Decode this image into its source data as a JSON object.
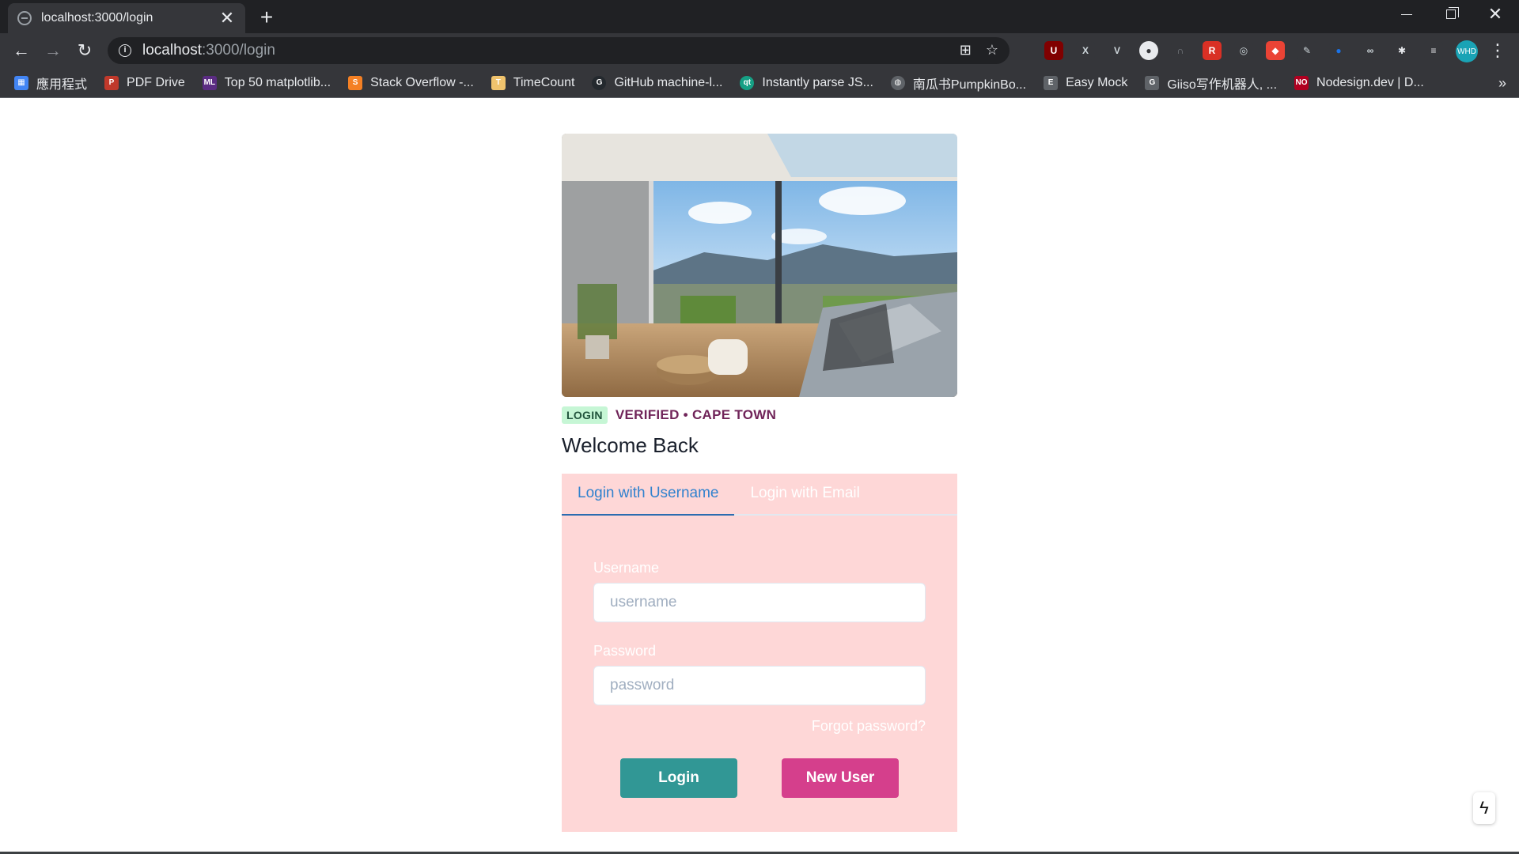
{
  "browser": {
    "tab_title": "localhost:3000/login",
    "new_tab_symbol": "+",
    "close_tab_symbol": "✕",
    "url_host": "localhost",
    "url_path": ":3000/login",
    "profile_initials": "WHD",
    "bookmarks": [
      {
        "label": "應用程式",
        "icon": "apps-grid-icon",
        "color": "#4285f4"
      },
      {
        "label": "PDF Drive",
        "icon": "pdf-drive-icon",
        "color": "#c0392b"
      },
      {
        "label": "Top 50 matplotlib...",
        "icon": "ml-icon",
        "color": "#5b2c83"
      },
      {
        "label": "Stack Overflow -...",
        "icon": "stackoverflow-icon",
        "color": "#f48024"
      },
      {
        "label": "TimeCount",
        "icon": "timecount-icon",
        "color": "#f0c36d"
      },
      {
        "label": "GitHub machine-l...",
        "icon": "github-icon",
        "color": "#24292e"
      },
      {
        "label": "Instantly parse JS...",
        "icon": "quicktype-icon",
        "color": "#16a085"
      },
      {
        "label": "南瓜书PumpkinBo...",
        "icon": "globe-icon",
        "color": "#5f6368"
      },
      {
        "label": "Easy Mock",
        "icon": "easymock-icon",
        "color": "#5f6368"
      },
      {
        "label": "Giiso写作机器人, ...",
        "icon": "giiso-icon",
        "color": "#5f6368"
      },
      {
        "label": "Nodesign.dev | D...",
        "icon": "nodesign-icon",
        "color": "#b00020"
      }
    ],
    "bookmarks_overflow": "»"
  },
  "hero": {
    "image_description_icon": "living-room-photo"
  },
  "meta": {
    "badge": "LOGIN",
    "subtitle": "VERIFIED • CAPE TOWN"
  },
  "heading": "Welcome Back",
  "tabs": [
    {
      "label": "Login with Username",
      "active": true
    },
    {
      "label": "Login with Email",
      "active": false
    }
  ],
  "form": {
    "username_label": "Username",
    "username_placeholder": "username",
    "username_value": "",
    "password_label": "Password",
    "password_placeholder": "password",
    "password_value": "",
    "forgot_label": "Forgot password?",
    "login_button": "Login",
    "new_user_button": "New User"
  },
  "colors": {
    "panel_bg": "#fed7d7",
    "login_button": "#319795",
    "new_user_button": "#d53f8c",
    "active_tab": "#3182ce",
    "badge_bg": "#c6f6d5",
    "subtitle": "#702459"
  }
}
